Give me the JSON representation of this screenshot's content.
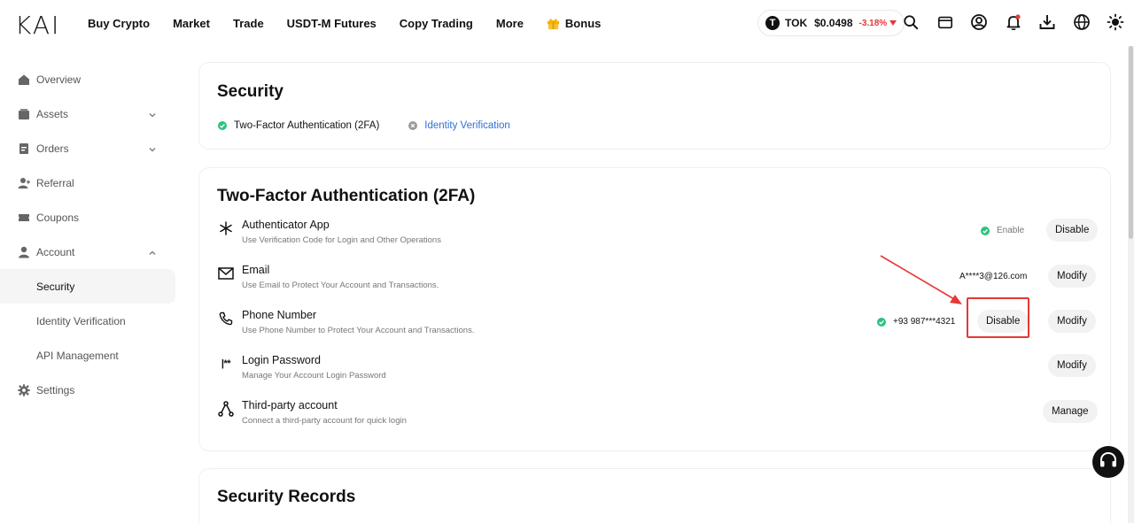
{
  "header": {
    "logo_text": "KAI",
    "nav": [
      "Buy Crypto",
      "Market",
      "Trade",
      "USDT-M Futures",
      "Copy Trading",
      "More"
    ],
    "bonus_label": "Bonus",
    "ticker": {
      "symbol": "TOK",
      "icon_letter": "T",
      "price": "$0.0498",
      "change": "-3.18%"
    },
    "icons": [
      "search-icon",
      "wallet-icon",
      "user-icon",
      "bell-icon",
      "download-icon",
      "globe-icon",
      "theme-icon"
    ]
  },
  "sidebar": {
    "items": [
      {
        "label": "Overview",
        "icon": "home-icon"
      },
      {
        "label": "Assets",
        "icon": "wallet-icon",
        "chevron": "down"
      },
      {
        "label": "Orders",
        "icon": "orders-icon",
        "chevron": "down"
      },
      {
        "label": "Referral",
        "icon": "referral-icon"
      },
      {
        "label": "Coupons",
        "icon": "coupon-icon"
      },
      {
        "label": "Account",
        "icon": "account-icon",
        "chevron": "up"
      },
      {
        "label": "Security",
        "active": true
      },
      {
        "label": "Identity Verification"
      },
      {
        "label": "API Management"
      },
      {
        "label": "Settings",
        "icon": "gear-icon"
      }
    ]
  },
  "security_card": {
    "title": "Security",
    "tabs": [
      {
        "label": "Two-Factor Authentication (2FA)",
        "status": "done"
      },
      {
        "label": "Identity Verification",
        "status": "not-done"
      }
    ]
  },
  "twofa": {
    "title": "Two-Factor Authentication (2FA)",
    "rows": [
      {
        "title": "Authenticator App",
        "desc": "Use Verification Code for Login and Other Operations",
        "status": "Enable",
        "buttons": [
          "Disable"
        ]
      },
      {
        "title": "Email",
        "desc": "Use Email to Protect Your Account and Transactions.",
        "value": "A****3@126.com",
        "buttons": [
          "Modify"
        ]
      },
      {
        "title": "Phone Number",
        "desc": "Use Phone Number to Protect Your Account and Transactions.",
        "value": "+93 987***4321",
        "buttons": [
          "Disable",
          "Modify"
        ]
      },
      {
        "title": "Login Password",
        "desc": "Manage Your Account Login Password",
        "buttons": [
          "Modify"
        ]
      },
      {
        "title": "Third-party account",
        "desc": "Connect a third-party account for quick login",
        "buttons": [
          "Manage"
        ]
      }
    ]
  },
  "records": {
    "title": "Security Records"
  },
  "colors": {
    "accent_link": "#2f6fd6",
    "success": "#2ec27e",
    "danger": "#e53935",
    "price_down": "#e5383b"
  }
}
